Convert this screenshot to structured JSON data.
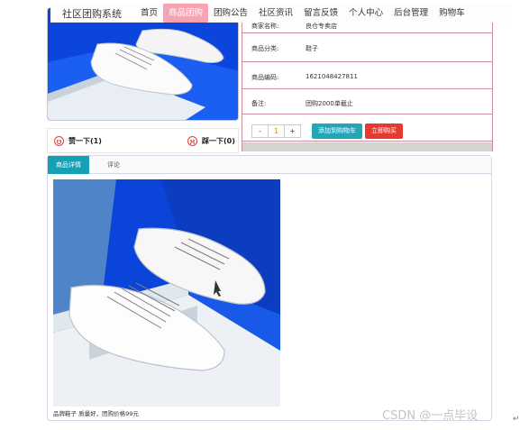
{
  "nav": {
    "brand": "社区团购系统",
    "items": [
      {
        "label": "首页",
        "active": false
      },
      {
        "label": "商品团购",
        "active": true
      },
      {
        "label": "团购公告",
        "active": false
      },
      {
        "label": "社区资讯",
        "active": false
      },
      {
        "label": "留言反馈",
        "active": false
      },
      {
        "label": "个人中心",
        "active": false
      },
      {
        "label": "后台管理",
        "active": false
      },
      {
        "label": "购物车",
        "active": false
      }
    ]
  },
  "details": {
    "rows": [
      {
        "key": "商家名称:",
        "value": "良仓专卖店"
      },
      {
        "key": "商品分类:",
        "value": "鞋子"
      },
      {
        "key": "商品编码:",
        "value": "1621048427811"
      },
      {
        "key": "备注:",
        "value": "团购2000单截止"
      }
    ],
    "quantity": {
      "minus": "-",
      "value": "1",
      "plus": "+"
    },
    "add_to_cart": "添加到购物车",
    "buy_now": "立即购买"
  },
  "votes": {
    "like": "赞一下(1)",
    "dislike": "踩一下(0)"
  },
  "tabs": [
    {
      "label": "商品详情",
      "active": true
    },
    {
      "label": "评论",
      "active": false
    }
  ],
  "caption": "品牌鞋子 质量好，团购价格99元",
  "watermark": "CSDN @一点毕设",
  "enter_mark": "↵",
  "colors": {
    "nav_active": "#f7a3b3",
    "cart_button": "#23a7b7",
    "buy_button": "#e53a2f",
    "tab_active": "#16a0b4",
    "table_border": "#cc8e98"
  }
}
